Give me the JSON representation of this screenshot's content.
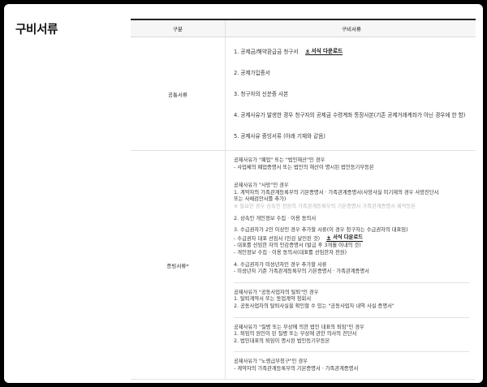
{
  "section_title": "구비서류",
  "table": {
    "header": {
      "col1": "구분",
      "col2": "구비서류"
    },
    "common": {
      "label": "공통서류",
      "items": [
        {
          "text": "1. 공제금/해약환급금 청구서",
          "download": "서식 다운로드"
        },
        {
          "text": "2. 공제가입증서"
        },
        {
          "text": "3. 청구자의 신분증 사본"
        },
        {
          "text": "4. 공제사유가 발생한 경우 청구자의 공제금 수령계좌 통장사본(기존 공제거래계좌가 아닌 경우에 한 함)"
        },
        {
          "text": "5. 공제사유 증빙서류 (아래 기재와 같음)"
        }
      ]
    },
    "evidence": {
      "label": "증빙서류*",
      "closure": {
        "title": "공제사유가 \"폐업\" 또는 \"법인해산\"인 경우",
        "l1": "-  사업체의 폐업증명서 또는 법인의 해산이 명시된 법인등기부등본"
      },
      "death": {
        "title": "공제사유가 \"사망\"인 경우",
        "l1": "1. 계약자의 가족관계등록부의 기본증명서 · 가족관계증명서(사망사실 미기재의 경우 사망진단서",
        "l2": "    또는 사체검안서를 추가)",
        "note": "※ 필요한 경우 상속인 전원의 가족관계등록부의 기본증명서 가족관계증명서 제적등본",
        "l3": "2. 상속인 개인정보 수집 · 이용 동의서",
        "l4": "3. 수급권자가 2인 이상인 경우 추가할 서류(이 경우 청구자는 수급권자의 대표임)",
        "l5": "  - 수급권자 대표 선임서 (인감 날인된 것)",
        "l5_download": "서식 다운로드",
        "l6": "  - 대표를 선임한 자의 인감증명서 (발급 후 3개월 이내의 것)",
        "l7": "  - 개인정보 수집 · 이용 동의서(대표를 선임한자 전원)",
        "l8": "4. 수급권자가 미성년자인 경우 추가할 서류",
        "l9": "  - 미성년자 기준 가족관계등록부의 기본증명서 · 가족관계증명서"
      },
      "withdrawal": {
        "title": "공제사유가 \"공동사업자의 탈퇴\"인 경우",
        "l1": "1. 탈퇴계약서 또는 동업계약 청회서",
        "l2": "2. 공동사업자의 탈퇴사실을 확인할 수 있는 \"공동사업자 내역 사실 증명서\""
      },
      "retire": {
        "title": "공제사유가 \"질병 또는 부상에 의한 법인 대표의 퇴임\"인 경우",
        "l1": "1. 퇴임의 원인이 된 질병 또는 부상에 관한 의사의 진단서",
        "l2": "2. 법인대표의 퇴임이 명시된 법인등기부등본"
      },
      "pension": {
        "title": "공제사유가 \"노령급부청구\"인 경우",
        "l1": "-  계약자의 가족관계등록부의 기본증명서 · 가족관계증명서"
      }
    }
  }
}
